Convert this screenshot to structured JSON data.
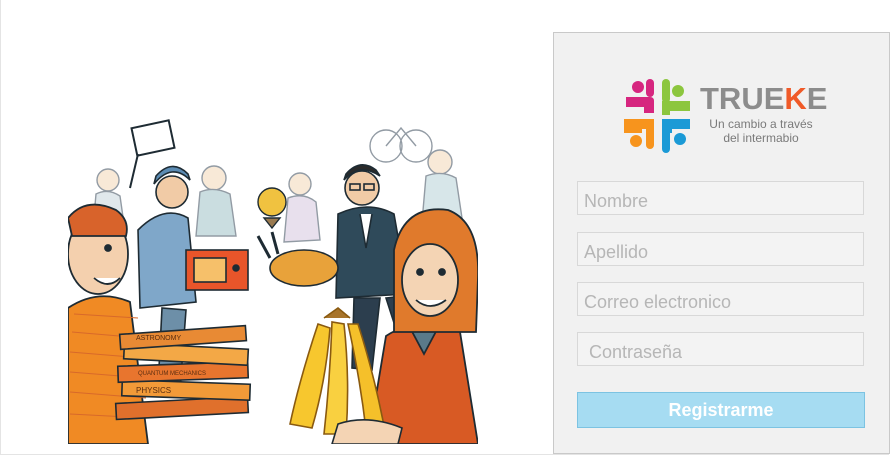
{
  "brand": {
    "name_start": "TRUE",
    "name_k": "K",
    "name_end": "E",
    "tagline_line1": "Un cambio a través",
    "tagline_line2": "del intermabio"
  },
  "form": {
    "nombre_placeholder": "Nombre",
    "apellido_placeholder": "Apellido",
    "correo_placeholder": "Correo electronico",
    "contrasena_placeholder": "Contraseña",
    "submit_label": "Registrarme"
  },
  "illustration": {
    "book_titles": [
      "PHYSICS",
      "QUANTUM MECHANICS",
      "ASTRONOMY"
    ]
  },
  "colors": {
    "logo_magenta": "#d6267f",
    "logo_green": "#8cc63e",
    "logo_orange": "#f7941d",
    "logo_blue": "#1b9ad6",
    "button_bg": "#a6dcf2",
    "panel_bg": "#f1f1f1"
  }
}
